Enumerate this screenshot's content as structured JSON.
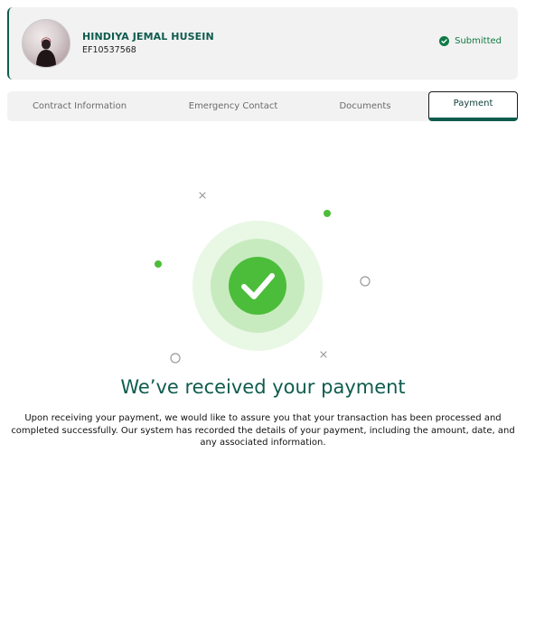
{
  "profile": {
    "name": "HINDIYA JEMAL HUSEIN",
    "employee_id": "EF10537568",
    "status": "Submitted",
    "status_color": "#0f7a43"
  },
  "tabs": [
    {
      "label": "Contract Information",
      "active": false
    },
    {
      "label": "Emergency Contact",
      "active": false
    },
    {
      "label": "Documents",
      "active": false
    },
    {
      "label": "Payment",
      "active": true
    }
  ],
  "confirmation": {
    "icon": "check-circle-icon",
    "title": "We’ve received your payment",
    "message": "Upon receiving your payment, we would like to assure you that your transaction has been processed and completed successfully. Our system has recorded the details of your payment, including the amount, date, and any associated information."
  },
  "colors": {
    "brand": "#0f5c4f",
    "success": "#4cbd3a",
    "success_light": "#c7ebbf",
    "success_lighter": "#e9f7e5"
  }
}
